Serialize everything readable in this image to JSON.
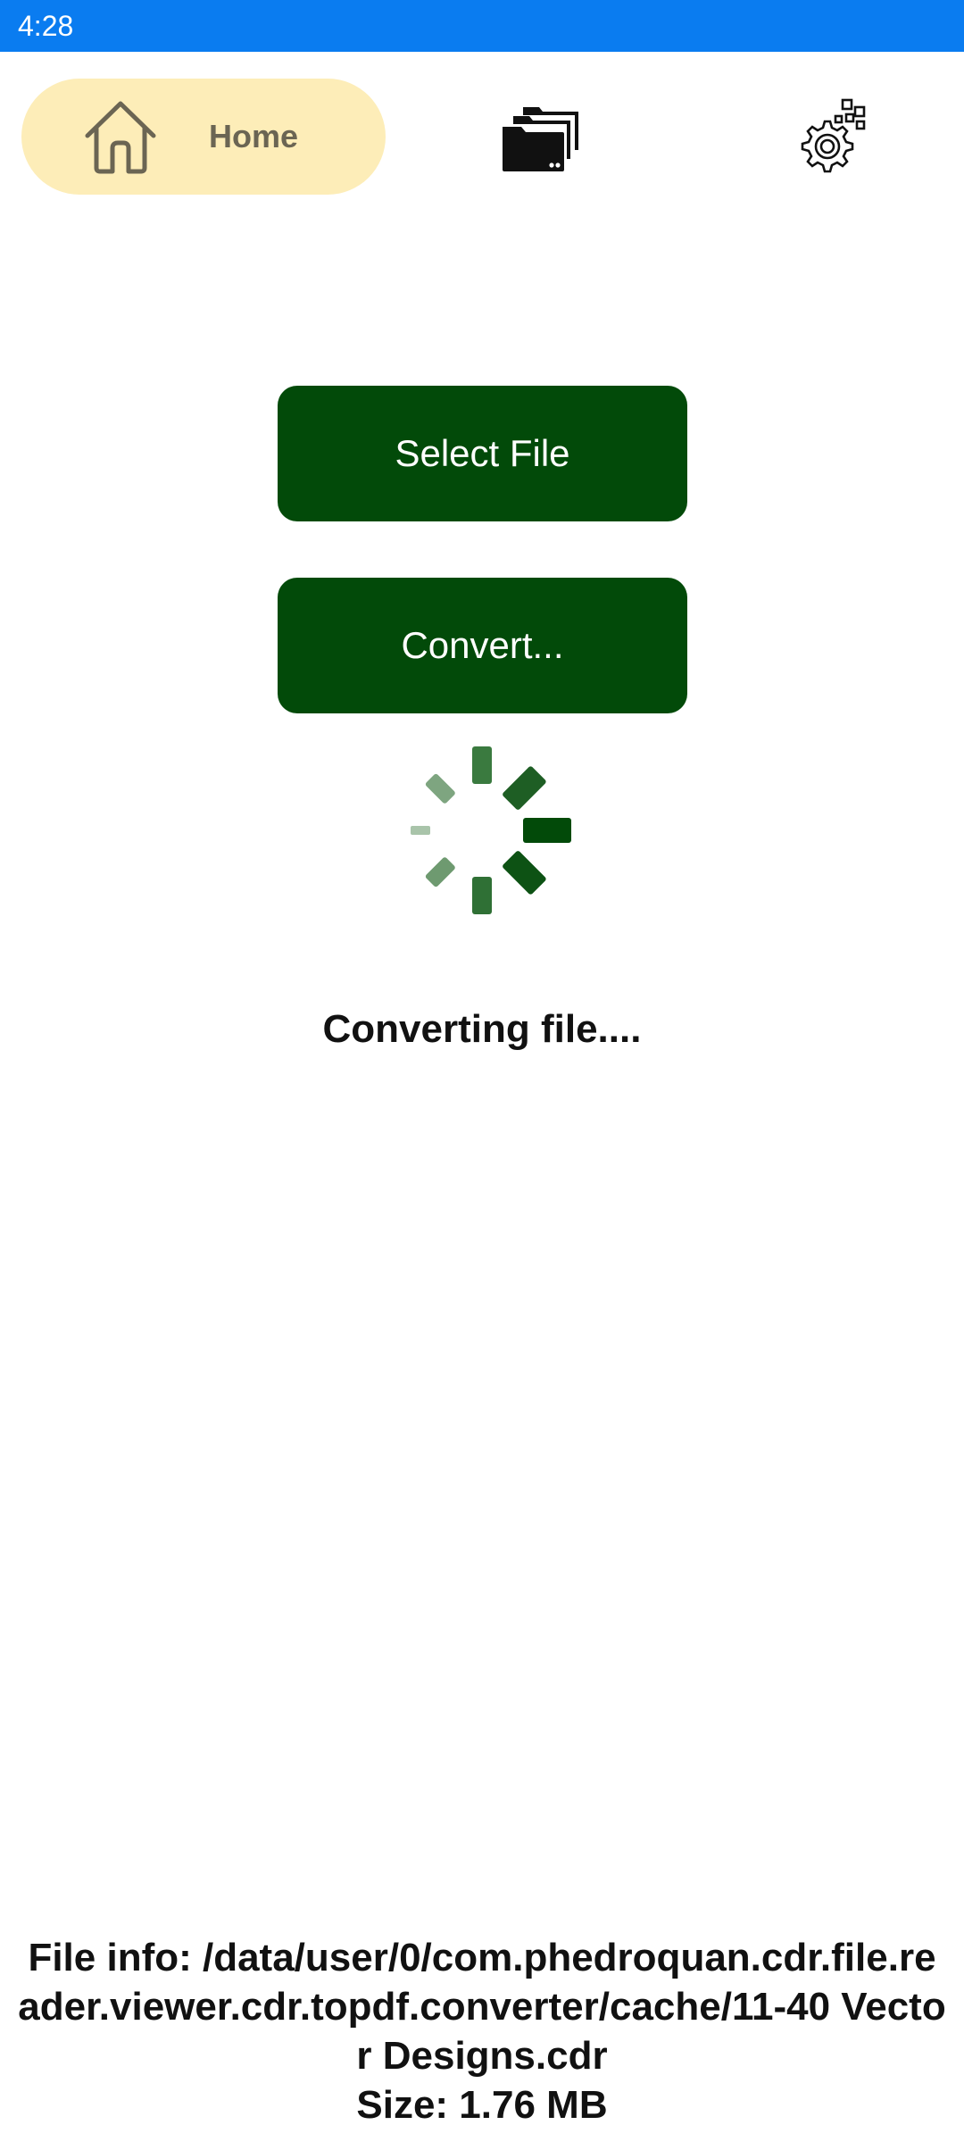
{
  "status_bar": {
    "time": "4:28"
  },
  "nav": {
    "home_label": "Home",
    "home_icon": "house-outline-icon",
    "files_icon": "stacked-folders-icon",
    "settings_icon": "gear-settings-icon",
    "home_bg_color": "#fdedb8"
  },
  "actions": {
    "select_file_label": "Select File",
    "convert_label": "Convert...",
    "button_color": "#024a09"
  },
  "progress": {
    "spinner_icon": "loading-spinner-icon",
    "status": "Converting file...."
  },
  "file": {
    "info": "File info: /data/user/0/com.phedroquan.cdr.file.reader.viewer.cdr.topdf.converter/cache/11-40 Vector Designs.cdr",
    "size": "Size: 1.76 MB"
  }
}
